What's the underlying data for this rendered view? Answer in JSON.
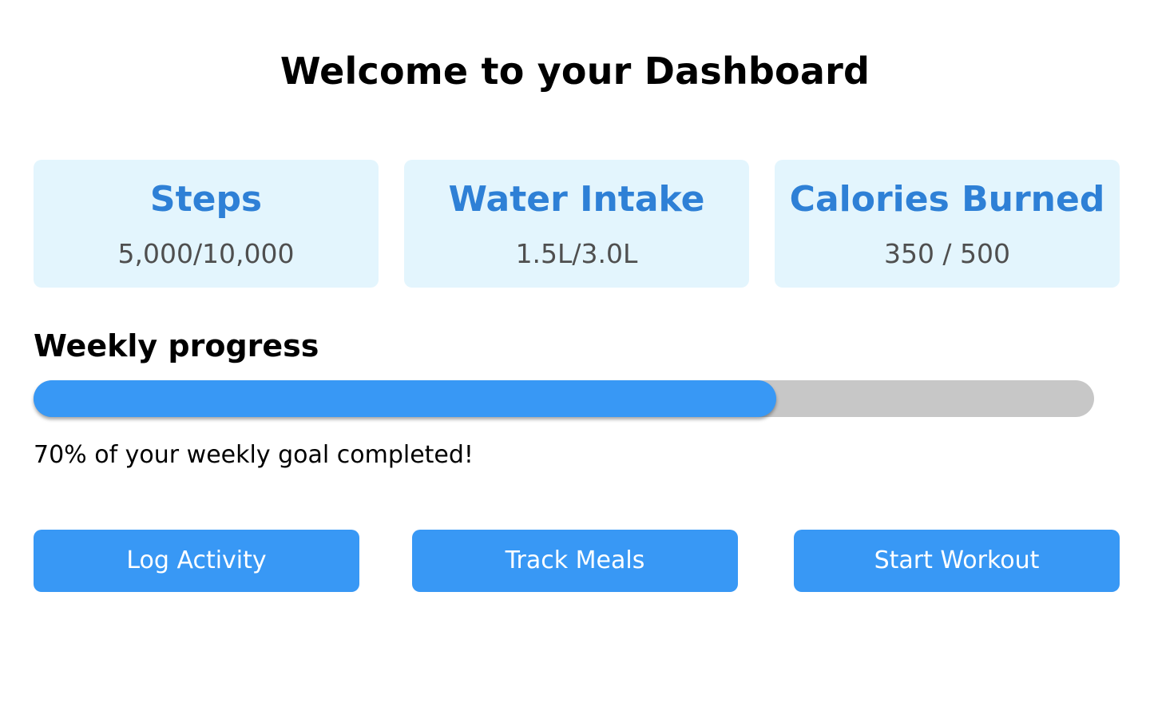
{
  "header": {
    "title": "Welcome to your Dashboard"
  },
  "stats": [
    {
      "title": "Steps",
      "value": "5,000/10,000"
    },
    {
      "title": "Water Intake",
      "value": "1.5L/3.0L"
    },
    {
      "title": "Calories Burned",
      "value": "350 / 500"
    }
  ],
  "progress": {
    "heading": "Weekly progress",
    "percent": 70,
    "message": "70% of your weekly goal completed!",
    "fill_color": "#3898f5",
    "track_color": "#c7c7c7"
  },
  "actions": [
    {
      "label": "Log Activity"
    },
    {
      "label": "Track Meals"
    },
    {
      "label": "Start Workout"
    }
  ],
  "colors": {
    "accent": "#3898f5",
    "card_background": "#e3f5fd",
    "card_title": "#2e80d6"
  }
}
